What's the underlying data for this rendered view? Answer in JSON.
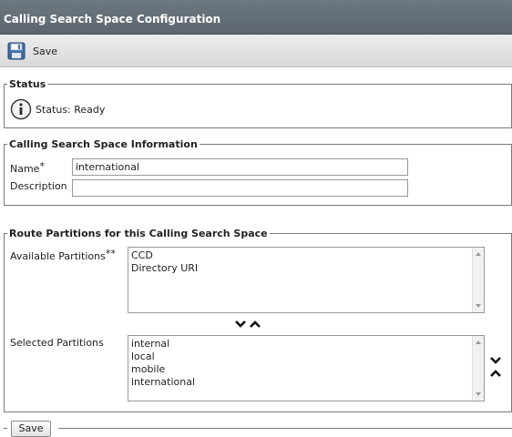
{
  "header": {
    "title": "Calling Search Space Configuration"
  },
  "toolbar": {
    "save_label": "Save",
    "save_icon": "floppy-disk-icon"
  },
  "status_section": {
    "legend": "Status",
    "icon": "info-icon",
    "text": "Status: Ready"
  },
  "info_section": {
    "legend": "Calling Search Space Information",
    "name_label": "Name",
    "name_required_mark": "*",
    "name_value": "international",
    "description_label": "Description",
    "description_value": ""
  },
  "partitions_section": {
    "legend": "Route Partitions for this Calling Search Space",
    "available_label": "Available Partitions",
    "available_required_mark": "**",
    "available_items": [
      "CCD",
      "Directory URI"
    ],
    "selected_label": "Selected Partitions",
    "selected_items": [
      "internal",
      "local",
      "mobile",
      "international"
    ]
  },
  "bottom": {
    "save_label": "Save"
  }
}
